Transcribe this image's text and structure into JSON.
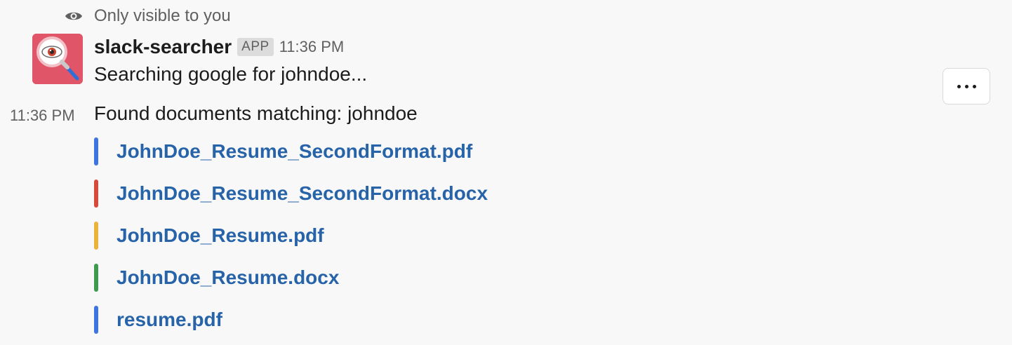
{
  "visibility": {
    "text": "Only visible to you",
    "icon": "eye-icon"
  },
  "message": {
    "avatar_icon": "magnifier-eye-icon",
    "avatar_color": "#e05568",
    "sender": "slack-searcher",
    "badge": "APP",
    "time": "11:36 PM",
    "text": "Searching google for johndoe..."
  },
  "followup": {
    "time": "11:36 PM",
    "text": "Found documents matching: johndoe"
  },
  "attachments": [
    {
      "name": "JohnDoe_Resume_SecondFormat.pdf",
      "color": "#3d74e0"
    },
    {
      "name": "JohnDoe_Resume_SecondFormat.docx",
      "color": "#d64a3c"
    },
    {
      "name": "JohnDoe_Resume.pdf",
      "color": "#ecb33b"
    },
    {
      "name": "JohnDoe_Resume.docx",
      "color": "#3d9a4e"
    },
    {
      "name": "resume.pdf",
      "color": "#3d74e0"
    }
  ],
  "more_actions_icon": "more-horizontal-icon",
  "colors": {
    "link": "#2763a8",
    "background": "#f8f8f8"
  }
}
